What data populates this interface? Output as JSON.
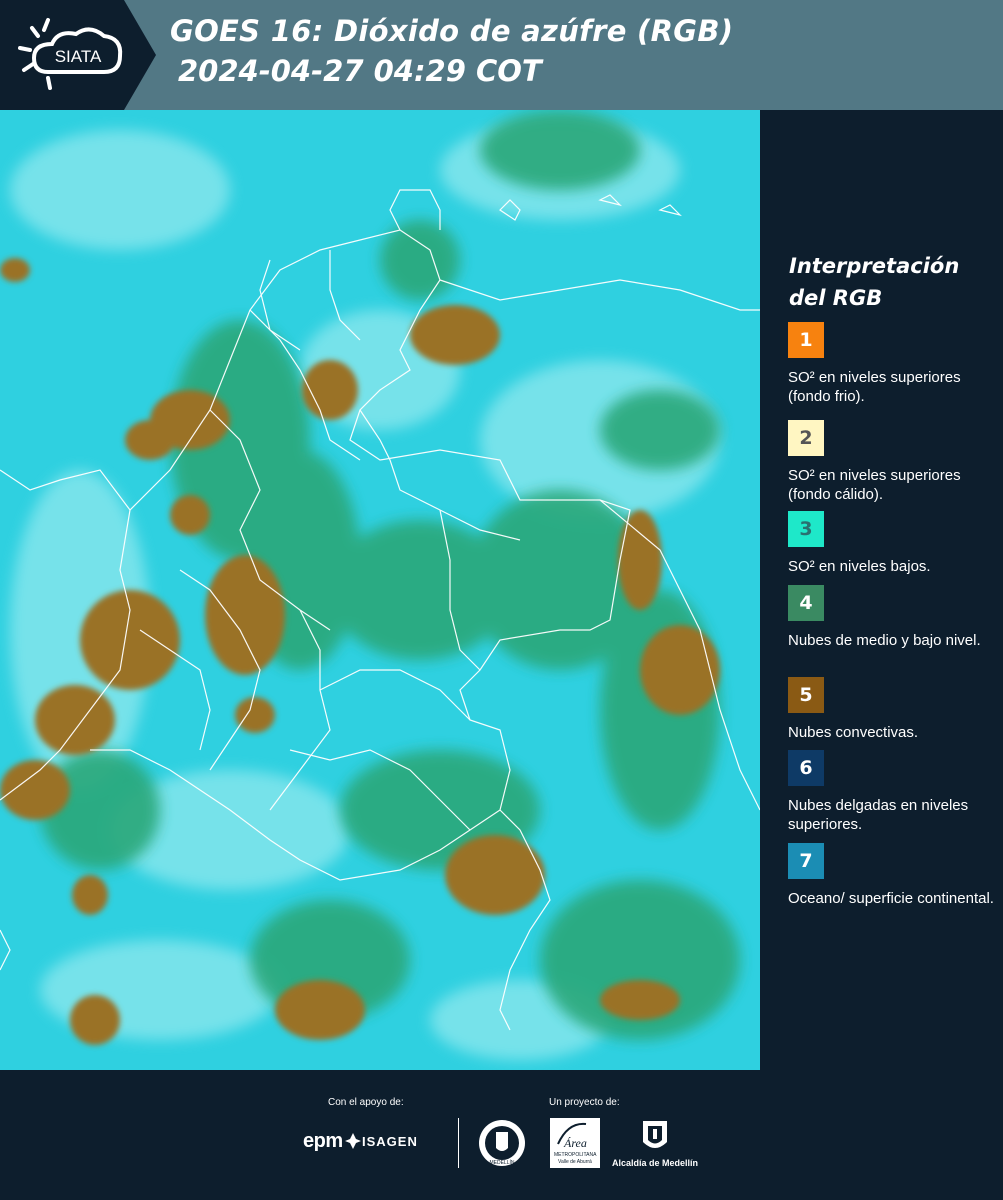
{
  "header": {
    "logo_text": "SIATA",
    "title": "GOES 16: Dióxido de azúfre (RGB)",
    "datetime": "2024-04-27 04:29 COT",
    "colors": {
      "bar": "#527885",
      "logo_bg": "#0d1e2d"
    }
  },
  "map": {
    "icon": "satellite-rgb-map",
    "colors": {
      "background": "#2fd0e0",
      "light": "#8ee8ee",
      "cloud": "#2aa87a",
      "convective": "#9a7226",
      "borders": "#ffffff"
    }
  },
  "legend": {
    "title_line1": "Interpretación",
    "title_line2": "del RGB",
    "items": [
      {
        "number": "1",
        "label": "SO² en niveles superiores (fondo frio).",
        "color": "#f7820f",
        "text_color": "#ffffff"
      },
      {
        "number": "2",
        "label": "SO² en niveles superiores (fondo cálido).",
        "color": "#fff6c2",
        "text_color": "#555555"
      },
      {
        "number": "3",
        "label": "SO² en niveles bajos.",
        "color": "#1ee8c9",
        "text_color": "#2a7070"
      },
      {
        "number": "4",
        "label": "Nubes de medio y bajo nivel.",
        "color": "#3a8a62",
        "text_color": "#ffffff"
      },
      {
        "number": "5",
        "label": "Nubes convectivas.",
        "color": "#8a5a14",
        "text_color": "#ffffff"
      },
      {
        "number": "6",
        "label": "Nubes delgadas en niveles superiores.",
        "color": "#0e3a66",
        "text_color": "#ffffff"
      },
      {
        "number": "7",
        "label": "Oceano/ superficie continental.",
        "color": "#1b8db4",
        "text_color": "#ffffff"
      }
    ]
  },
  "footer": {
    "support_label": "Con el apoyo de:",
    "project_label": "Un proyecto de:",
    "sponsor_epm": "epm",
    "sponsor_isagen": "ISAGEN",
    "logo_area_line1": "Área",
    "logo_area_line2": "METROPOLITANA",
    "logo_area_line3": "Valle de Aburrá",
    "logo_medellin_seal": "MEDELLÍN",
    "logo_alcaldia": "Alcaldía de Medellín"
  }
}
